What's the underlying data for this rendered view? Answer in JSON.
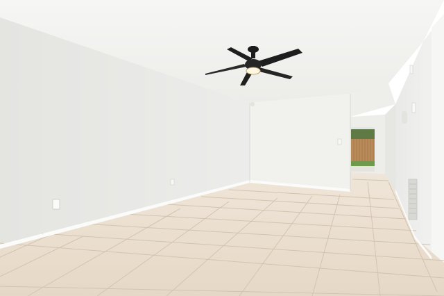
{
  "scene": {
    "description_visible_text": [],
    "colors": {
      "ceiling": "#f4f4f2",
      "ceiling_shadow": "#e7e7e4",
      "left_wall": "#e9e9e6",
      "back_wall": "#f1f1ee",
      "right_wall": "#ececea",
      "far_right_wall": "#f5f5f3",
      "floor": "#e9dccb",
      "floor_far": "#efe4d6",
      "grout": "#cdbfad",
      "baseboard": "#fbfbfa",
      "fan_body": "#1c1c1c",
      "fan_light": "#fff7e0",
      "fence": "#b98a5a",
      "grass": "#6e9a4e",
      "vent": "#d8d8d5"
    }
  }
}
